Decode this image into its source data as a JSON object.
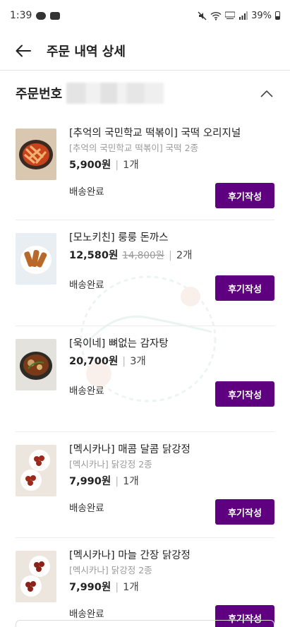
{
  "status_bar": {
    "time": "1:39",
    "battery": "39%"
  },
  "header": {
    "title": "주문 내역 상세"
  },
  "order": {
    "label": "주문번호"
  },
  "items": [
    {
      "title": "[추억의 국민학교 떡볶이] 국떡 오리지널",
      "option": "[추억의 국민학교 떡볶이] 국떡 2종",
      "price": "5,900원",
      "original_price": "",
      "quantity": "1개",
      "status": "배송완료",
      "button": "후기작성"
    },
    {
      "title": "[모노키친] 룽룽 돈까스",
      "option": "",
      "price": "12,580원",
      "original_price": "14,800원",
      "quantity": "2개",
      "status": "배송완료",
      "button": "후기작성"
    },
    {
      "title": "[욱이네] 뼈없는 감자탕",
      "option": "",
      "price": "20,700원",
      "original_price": "",
      "quantity": "3개",
      "status": "배송완료",
      "button": "후기작성"
    },
    {
      "title": "[멕시카나] 매콤 달콤 닭강정",
      "option": "[멕시카나] 닭강정 2종",
      "price": "7,990원",
      "original_price": "",
      "quantity": "1개",
      "status": "배송완료",
      "button": "후기작성"
    },
    {
      "title": "[멕시카나] 마늘 간장 닭강정",
      "option": "[멕시카나] 닭강정 2종",
      "price": "7,990원",
      "original_price": "",
      "quantity": "1개",
      "status": "배송완료",
      "button": "후기작성"
    }
  ],
  "colors": {
    "accent": "#5f0080",
    "divider": "#ececec",
    "muted_text": "#9a9a9a"
  }
}
